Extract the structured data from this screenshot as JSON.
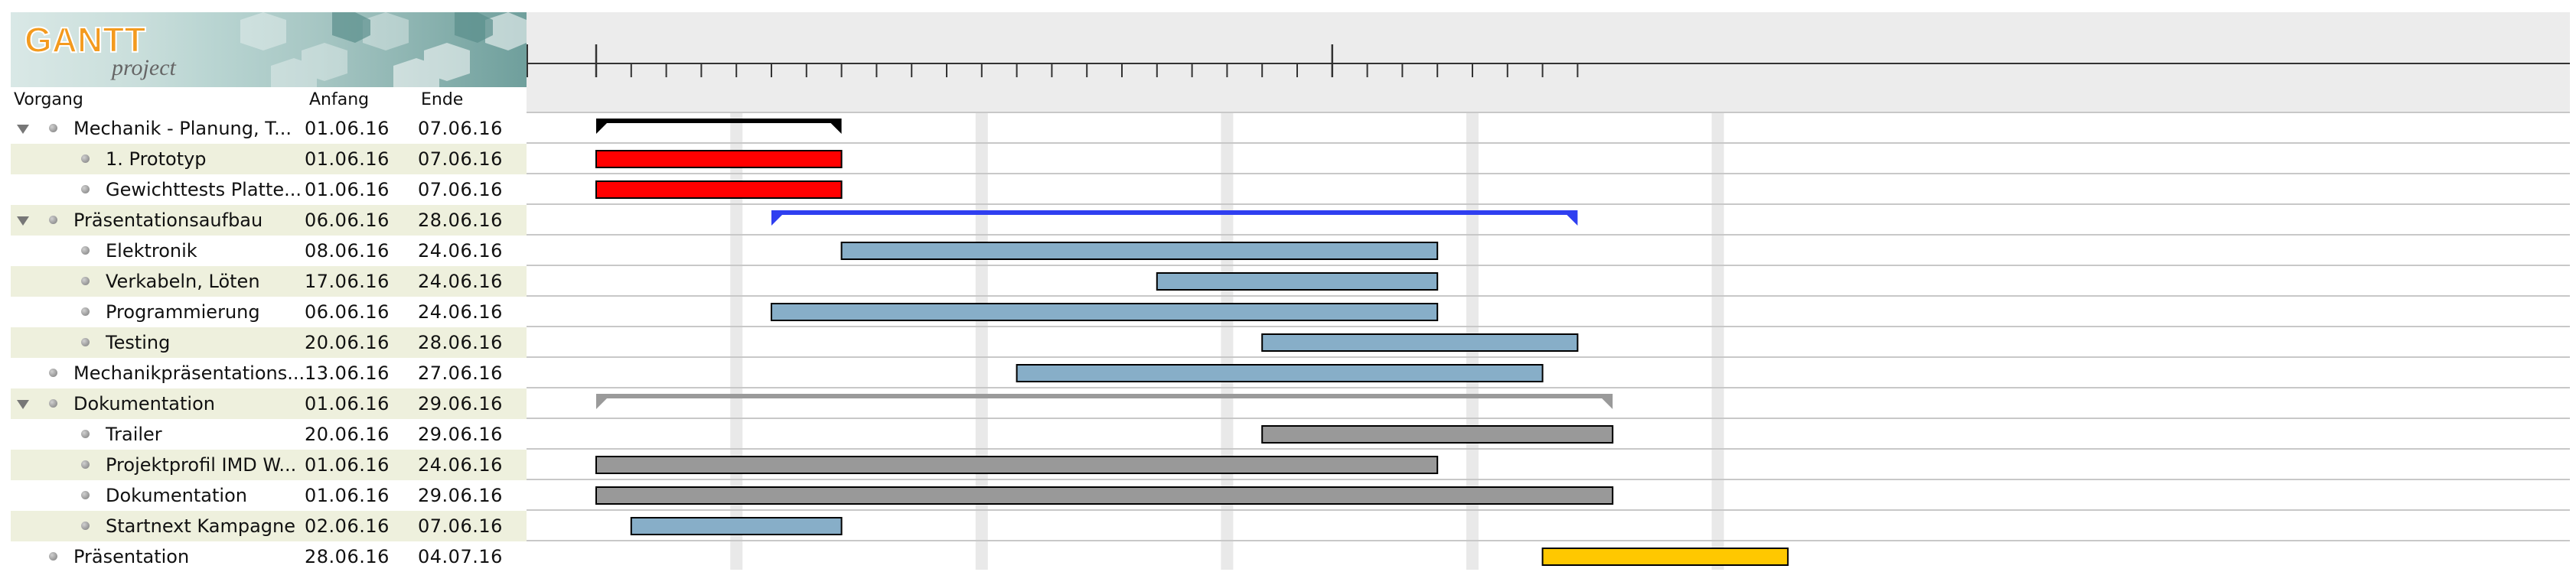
{
  "columns": {
    "name": "Vorgang",
    "start": "Anfang",
    "end": "Ende"
  },
  "logo": {
    "word1": "GANTT",
    "word2": "project"
  },
  "colors": {
    "summary_black": "#000000",
    "summary_blue": "#2f3ff0",
    "summary_gray": "#9a9a9a",
    "bar_red": "#ff0000",
    "bar_blue": "#87aec8",
    "bar_gray": "#999999",
    "bar_yellow": "#ffc800",
    "row_alt": "#eef0dd",
    "weekend_stripe": "#e9e9e9"
  },
  "tasks": [
    {
      "name": "Mechanik - Planung, T...",
      "start": "01.06.16",
      "end": "07.06.16",
      "level": 0,
      "has_children": true
    },
    {
      "name": "1. Prototyp",
      "start": "01.06.16",
      "end": "07.06.16",
      "level": 1,
      "has_children": false
    },
    {
      "name": "Gewichttests Platte...",
      "start": "01.06.16",
      "end": "07.06.16",
      "level": 1,
      "has_children": false
    },
    {
      "name": "Präsentationsaufbau",
      "start": "06.06.16",
      "end": "28.06.16",
      "level": 0,
      "has_children": true
    },
    {
      "name": "Elektronik",
      "start": "08.06.16",
      "end": "24.06.16",
      "level": 1,
      "has_children": false
    },
    {
      "name": "Verkabeln, Löten",
      "start": "17.06.16",
      "end": "24.06.16",
      "level": 1,
      "has_children": false
    },
    {
      "name": "Programmierung",
      "start": "06.06.16",
      "end": "24.06.16",
      "level": 1,
      "has_children": false
    },
    {
      "name": "Testing",
      "start": "20.06.16",
      "end": "28.06.16",
      "level": 1,
      "has_children": false
    },
    {
      "name": "Mechanikpräsentations...",
      "start": "13.06.16",
      "end": "27.06.16",
      "level": 0,
      "has_children": false
    },
    {
      "name": "Dokumentation",
      "start": "01.06.16",
      "end": "29.06.16",
      "level": 0,
      "has_children": true
    },
    {
      "name": "Trailer",
      "start": "20.06.16",
      "end": "29.06.16",
      "level": 1,
      "has_children": false
    },
    {
      "name": "Projektprofil IMD W...",
      "start": "01.06.16",
      "end": "24.06.16",
      "level": 1,
      "has_children": false
    },
    {
      "name": "Dokumentation",
      "start": "01.06.16",
      "end": "29.06.16",
      "level": 1,
      "has_children": false
    },
    {
      "name": "Startnext Kampagne",
      "start": "02.06.16",
      "end": "07.06.16",
      "level": 1,
      "has_children": false
    },
    {
      "name": "Präsentation",
      "start": "28.06.16",
      "end": "04.07.16",
      "level": 0,
      "has_children": false
    }
  ],
  "bars": [
    {
      "task": 0,
      "kind": "summary",
      "color": "#000000"
    },
    {
      "task": 1,
      "kind": "bar",
      "color": "#ff0000"
    },
    {
      "task": 2,
      "kind": "bar",
      "color": "#ff0000"
    },
    {
      "task": 3,
      "kind": "summary",
      "color": "#2f3ff0"
    },
    {
      "task": 4,
      "kind": "bar",
      "color": "#87aec8"
    },
    {
      "task": 5,
      "kind": "bar",
      "color": "#87aec8"
    },
    {
      "task": 6,
      "kind": "bar",
      "color": "#87aec8"
    },
    {
      "task": 7,
      "kind": "bar",
      "color": "#87aec8"
    },
    {
      "task": 8,
      "kind": "bar",
      "color": "#87aec8"
    },
    {
      "task": 9,
      "kind": "summary",
      "color": "#9a9a9a"
    },
    {
      "task": 10,
      "kind": "bar",
      "color": "#999999"
    },
    {
      "task": 11,
      "kind": "bar",
      "color": "#999999"
    },
    {
      "task": 12,
      "kind": "bar",
      "color": "#999999"
    },
    {
      "task": 13,
      "kind": "bar",
      "color": "#87aec8"
    },
    {
      "task": 14,
      "kind": "bar",
      "color": "#ffc800"
    }
  ],
  "icons": {
    "collapse": "triangle-down-icon",
    "node": "task-dot-icon"
  }
}
